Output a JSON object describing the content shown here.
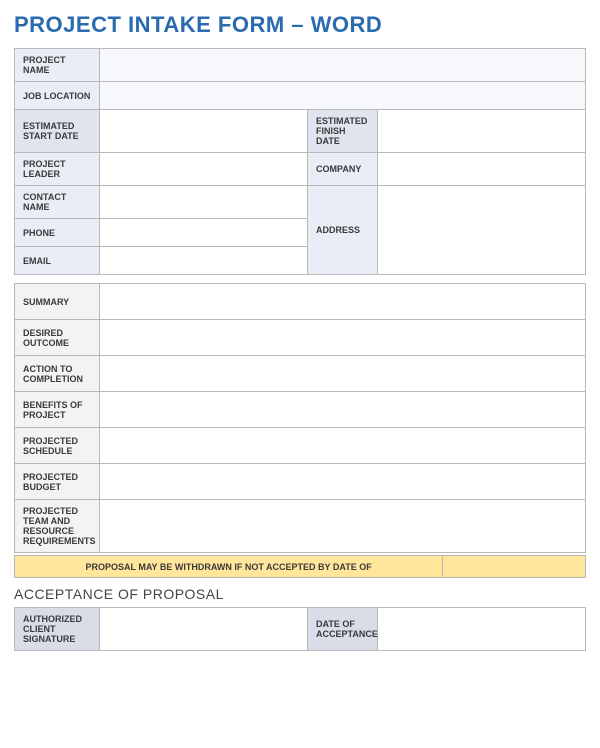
{
  "title": "PROJECT INTAKE FORM – WORD",
  "fields": {
    "project_name": "PROJECT NAME",
    "job_location": "JOB LOCATION",
    "estimated_start": "ESTIMATED START DATE",
    "estimated_finish": "ESTIMATED FINISH DATE",
    "project_leader": "PROJECT LEADER",
    "company": "COMPANY",
    "contact_name": "CONTACT NAME",
    "address": "ADDRESS",
    "phone": "PHONE",
    "email": "EMAIL"
  },
  "details": {
    "summary": "SUMMARY",
    "desired_outcome": "DESIRED OUTCOME",
    "action_to_completion": "ACTION TO COMPLETION",
    "benefits": "BENEFITS OF PROJECT",
    "schedule": "PROJECTED SCHEDULE",
    "budget": "PROJECTED BUDGET",
    "team": "PROJECTED TEAM AND RESOURCE REQUIREMENTS"
  },
  "banner": "PROPOSAL MAY BE WITHDRAWN IF NOT ACCEPTED BY DATE OF",
  "acceptance": {
    "heading": "ACCEPTANCE OF PROPOSAL",
    "signature": "AUTHORIZED CLIENT SIGNATURE",
    "date": "DATE OF ACCEPTANCE"
  }
}
